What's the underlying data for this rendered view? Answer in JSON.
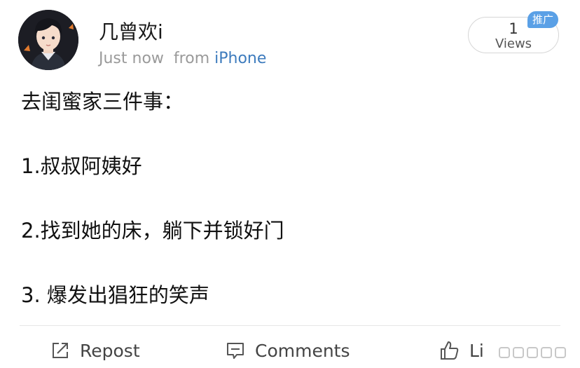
{
  "author": {
    "name": "几曾欢i",
    "time": "Just now",
    "from_label": "from",
    "device": "iPhone"
  },
  "views": {
    "count": "1",
    "label": "Views",
    "promo_badge": "推广"
  },
  "post": {
    "lines": [
      "去闺蜜家三件事：",
      "1.叔叔阿姨好",
      "2.找到她的床，躺下并锁好门",
      "3. 爆发出猖狂的笑声"
    ]
  },
  "actions": {
    "repost": "Repost",
    "comments": "Comments",
    "like": "Li"
  },
  "icons": {
    "repost": "repost-icon",
    "comments": "comments-icon",
    "like": "thumbs-up-icon"
  },
  "colors": {
    "link": "#3d7bbd",
    "badge": "#5aa0e6",
    "meta": "#9a9a9a"
  }
}
